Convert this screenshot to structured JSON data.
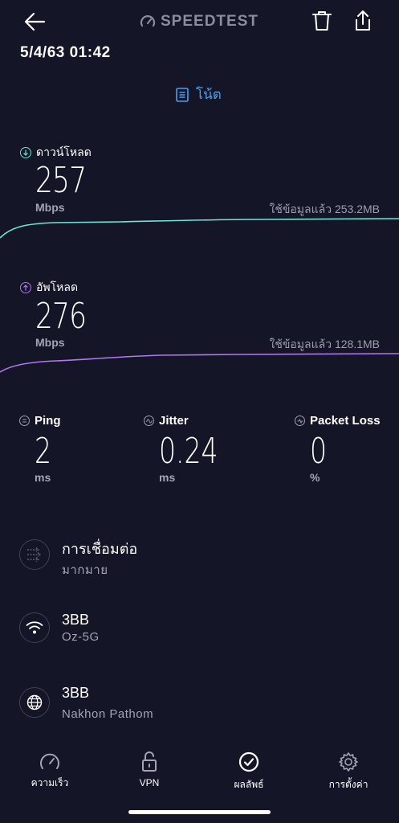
{
  "header": {
    "brand": "SPEEDTEST",
    "datetime": "5/4/63 01:42",
    "note_label": "โน้ต"
  },
  "download": {
    "label": "ดาวน์โหลด",
    "value": "257",
    "unit": "Mbps",
    "data_used": "ใช้ข้อมูลแล้ว 253.2MB",
    "color": "#6fe4d6"
  },
  "upload": {
    "label": "อัพโหลด",
    "value": "276",
    "unit": "Mbps",
    "data_used": "ใช้ข้อมูลแล้ว 128.1MB",
    "color": "#b476f2"
  },
  "stats": {
    "ping": {
      "label": "Ping",
      "value": "2",
      "unit": "ms"
    },
    "jitter": {
      "label": "Jitter",
      "value": "0.24",
      "unit": "ms"
    },
    "packet_loss": {
      "label": "Packet Loss",
      "value": "0",
      "unit": "%"
    }
  },
  "info": {
    "connection": {
      "title": "การเชื่อมต่อ",
      "sub": "มากมาย"
    },
    "wifi": {
      "title": "3BB",
      "sub": "Oz-5G"
    },
    "server": {
      "title": "3BB",
      "sub": "Nakhon Pathom"
    }
  },
  "nav": {
    "speed": "ความเร็ว",
    "vpn": "VPN",
    "results": "ผลลัพธ์",
    "settings": "การตั้งค่า"
  },
  "colors": {
    "background": "#141526",
    "accent_blue": "#4a9ff0"
  }
}
